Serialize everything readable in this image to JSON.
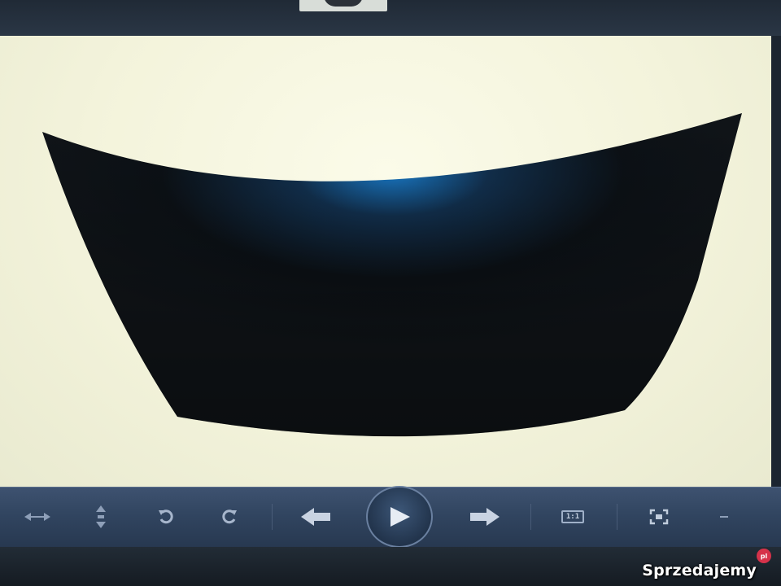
{
  "viewer": {
    "image_subject": "car-hood-photo"
  },
  "toolbar": {
    "buttons": [
      {
        "icon": "fit-width-icon"
      },
      {
        "icon": "fit-height-icon"
      },
      {
        "icon": "rotate-left-icon"
      },
      {
        "icon": "rotate-right-icon"
      },
      {
        "icon": "previous-arrow-icon"
      },
      {
        "icon": "play-slideshow-icon"
      },
      {
        "icon": "next-arrow-icon"
      },
      {
        "icon": "actual-size-icon",
        "label": "1:1"
      },
      {
        "icon": "fullscreen-icon"
      },
      {
        "icon": "minimize-icon"
      }
    ]
  },
  "watermark": {
    "text": "Sprzedajemy",
    "tld": "pl"
  },
  "colors": {
    "toolbar": "#314560",
    "viewer_background": "#f3f3db",
    "hood": "#111519",
    "hood_highlight": "#1a7fd0",
    "watermark_badge": "#d6324a"
  }
}
